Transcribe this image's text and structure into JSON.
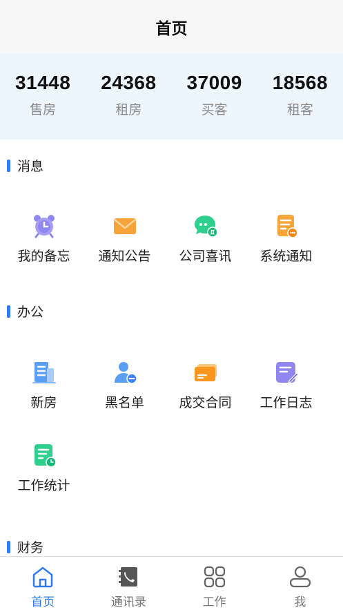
{
  "header": {
    "title": "首页"
  },
  "stats": [
    {
      "value": "31448",
      "label": "售房"
    },
    {
      "value": "24368",
      "label": "租房"
    },
    {
      "value": "37009",
      "label": "买客"
    },
    {
      "value": "18568",
      "label": "租客"
    }
  ],
  "sections": {
    "messages": {
      "title": "消息",
      "items": [
        {
          "label": "我的备忘",
          "icon": "alarm-clock-icon",
          "color": "#8f86f0"
        },
        {
          "label": "通知公告",
          "icon": "envelope-icon",
          "color": "#f7a33c"
        },
        {
          "label": "公司喜讯",
          "icon": "chat-bubble-icon",
          "color": "#2fcf8d"
        },
        {
          "label": "系统通知",
          "icon": "document-icon",
          "color": "#f8a53a"
        }
      ]
    },
    "office": {
      "title": "办公",
      "items": [
        {
          "label": "新房",
          "icon": "building-icon",
          "color": "#5b9ef5"
        },
        {
          "label": "黑名单",
          "icon": "user-block-icon",
          "color": "#5b9ef5"
        },
        {
          "label": "成交合同",
          "icon": "card-icon",
          "color": "#f8a53a"
        },
        {
          "label": "工作日志",
          "icon": "edit-note-icon",
          "color": "#8f86f0"
        },
        {
          "label": "工作统计",
          "icon": "report-icon",
          "color": "#2fcf8d"
        }
      ]
    },
    "finance": {
      "title": "财务"
    }
  },
  "tabbar": {
    "active_color": "#2f7bf5",
    "items": [
      {
        "label": "首页",
        "icon": "home-icon",
        "active": true
      },
      {
        "label": "通讯录",
        "icon": "contacts-icon",
        "active": false
      },
      {
        "label": "工作",
        "icon": "grid-icon",
        "active": false
      },
      {
        "label": "我",
        "icon": "user-icon",
        "active": false
      }
    ]
  }
}
